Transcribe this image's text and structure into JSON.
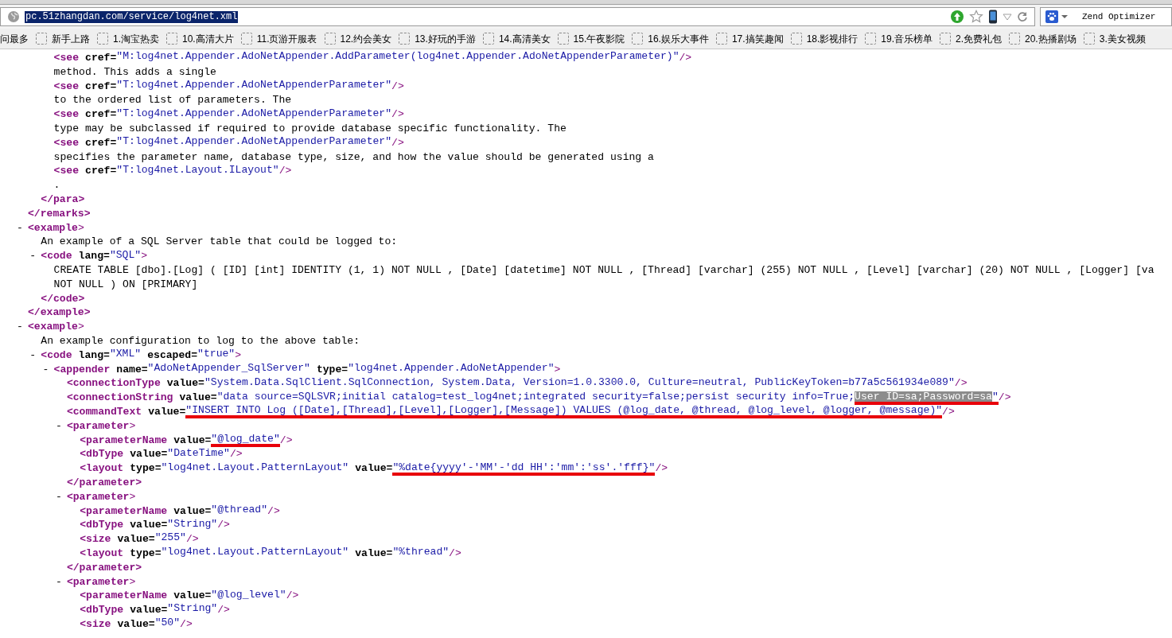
{
  "address_bar": {
    "url": "pc.51zhangdan.com/service/log4net.xml",
    "url_selected": true
  },
  "search_field": {
    "placeholder": "Zend Optimizer"
  },
  "bookmarks": [
    {
      "label": "问最多",
      "kind": "text"
    },
    {
      "label": "新手上路",
      "kind": "page"
    },
    {
      "label": "1.淘宝热卖",
      "kind": "page"
    },
    {
      "label": "10.高清大片",
      "kind": "page"
    },
    {
      "label": "11.页游开服表",
      "kind": "page"
    },
    {
      "label": "12.约会美女",
      "kind": "page"
    },
    {
      "label": "13.好玩的手游",
      "kind": "page"
    },
    {
      "label": "14.高清美女",
      "kind": "page"
    },
    {
      "label": "15.午夜影院",
      "kind": "page"
    },
    {
      "label": "16.娱乐大事件",
      "kind": "page"
    },
    {
      "label": "17.搞笑趣闻",
      "kind": "page"
    },
    {
      "label": "18.影视排行",
      "kind": "page"
    },
    {
      "label": "19.音乐榜单",
      "kind": "page"
    },
    {
      "label": "2.免费礼包",
      "kind": "page"
    },
    {
      "label": "20.热播剧场",
      "kind": "page"
    },
    {
      "label": "3.美女视频",
      "kind": "page"
    }
  ],
  "xml_view": [
    {
      "kind": "element",
      "close_tag": [
        {
          "kind": "close",
          "text": "</remarks>"
        }
      ],
      "children": [
        {
          "kind": "element",
          "close_tag": [
            {
              "kind": "close",
              "text": "</para>"
            }
          ],
          "children": [
            {
              "kind": "empty",
              "tag": [
                {
                  "kind": "open",
                  "text": "<see"
                },
                {
                  "kind": "attr",
                  "text": "cref="
                },
                {
                  "kind": "value",
                  "text": "\"M:log4net.Appender.AdoNetAppender.AddParameter(log4net.Appender.AdoNetAppenderParameter)\"",
                  "underlined": false
                },
                {
                  "kind": "end",
                  "text": "/>"
                }
              ]
            },
            {
              "kind": "text",
              "text": "method. This adds a single"
            },
            {
              "kind": "empty",
              "tag": [
                {
                  "kind": "open",
                  "text": "<see"
                },
                {
                  "kind": "attr",
                  "text": "cref="
                },
                {
                  "kind": "value",
                  "text": "\"T:log4net.Appender.AdoNetAppenderParameter\"",
                  "underlined": false
                },
                {
                  "kind": "end",
                  "text": "/>"
                }
              ]
            },
            {
              "kind": "text",
              "text": "to the ordered list of parameters. The"
            },
            {
              "kind": "empty",
              "tag": [
                {
                  "kind": "open",
                  "text": "<see"
                },
                {
                  "kind": "attr",
                  "text": "cref="
                },
                {
                  "kind": "value",
                  "text": "\"T:log4net.Appender.AdoNetAppenderParameter\"",
                  "underlined": false
                },
                {
                  "kind": "end",
                  "text": "/>"
                }
              ]
            },
            {
              "kind": "text",
              "text": "type may be subclassed if required to provide database specific functionality. The"
            },
            {
              "kind": "empty",
              "tag": [
                {
                  "kind": "open",
                  "text": "<see"
                },
                {
                  "kind": "attr",
                  "text": "cref="
                },
                {
                  "kind": "value",
                  "text": "\"T:log4net.Appender.AdoNetAppenderParameter\"",
                  "underlined": false
                },
                {
                  "kind": "end",
                  "text": "/>"
                }
              ]
            },
            {
              "kind": "text",
              "text": "specifies the parameter name, database type, size, and how the value should be generated using a"
            },
            {
              "kind": "empty",
              "tag": [
                {
                  "kind": "open",
                  "text": "<see"
                },
                {
                  "kind": "attr",
                  "text": "cref="
                },
                {
                  "kind": "value",
                  "text": "\"T:log4net.Layout.ILayout\"",
                  "underlined": false
                },
                {
                  "kind": "end",
                  "text": "/>"
                }
              ]
            },
            {
              "kind": "text",
              "text": "."
            }
          ]
        }
      ]
    },
    {
      "kind": "element",
      "toggle": "-",
      "open_tag": [
        {
          "kind": "open",
          "text": "<example"
        },
        {
          "kind": "end",
          "text": ">"
        }
      ],
      "close_tag": [
        {
          "kind": "close",
          "text": "</example>"
        }
      ],
      "children": [
        {
          "kind": "text",
          "text": "An example of a SQL Server table that could be logged to:"
        },
        {
          "kind": "element",
          "toggle": "-",
          "open_tag": [
            {
              "kind": "open",
              "text": "<code"
            },
            {
              "kind": "attr",
              "text": "lang="
            },
            {
              "kind": "value",
              "text": "\"SQL\"",
              "underlined": false
            },
            {
              "kind": "end",
              "text": ">"
            }
          ],
          "close_tag": [
            {
              "kind": "close",
              "text": "</code>"
            }
          ],
          "children": [
            {
              "kind": "text",
              "text": "CREATE TABLE [dbo].[Log] ( [ID] [int] IDENTITY (1, 1) NOT NULL , [Date] [datetime] NOT NULL , [Thread] [varchar] (255) NOT NULL , [Level] [varchar] (20) NOT NULL , [Logger] [va"
            },
            {
              "kind": "text",
              "text": "NOT NULL ) ON [PRIMARY]"
            }
          ]
        }
      ]
    },
    {
      "kind": "element",
      "toggle": "-",
      "open_tag": [
        {
          "kind": "open",
          "text": "<example"
        },
        {
          "kind": "end",
          "text": ">"
        }
      ],
      "children": [
        {
          "kind": "text",
          "text": "An example configuration to log to the above table:"
        },
        {
          "kind": "element",
          "toggle": "-",
          "open_tag": [
            {
              "kind": "open",
              "text": "<code"
            },
            {
              "kind": "attr",
              "text": "lang="
            },
            {
              "kind": "value",
              "text": "\"XML\"",
              "underlined": false
            },
            {
              "kind": "attr",
              "text": "escaped="
            },
            {
              "kind": "value",
              "text": "\"true\"",
              "underlined": false
            },
            {
              "kind": "end",
              "text": ">"
            }
          ],
          "children": [
            {
              "kind": "element",
              "toggle": "-",
              "open_tag": [
                {
                  "kind": "open",
                  "text": "<appender"
                },
                {
                  "kind": "attr",
                  "text": "name="
                },
                {
                  "kind": "value",
                  "text": "\"AdoNetAppender_SqlServer\"",
                  "underlined": false
                },
                {
                  "kind": "attr",
                  "text": "type="
                },
                {
                  "kind": "value",
                  "text": "\"log4net.Appender.AdoNetAppender\"",
                  "underlined": false
                },
                {
                  "kind": "end",
                  "text": ">"
                }
              ],
              "children": [
                {
                  "kind": "empty",
                  "tag": [
                    {
                      "kind": "open",
                      "text": "<connectionType"
                    },
                    {
                      "kind": "attr",
                      "text": "value="
                    },
                    {
                      "kind": "value",
                      "text": "\"System.Data.SqlClient.SqlConnection, System.Data, Version=1.0.3300.0, Culture=neutral, PublicKeyToken=b77a5c561934e089\"",
                      "underlined": false
                    },
                    {
                      "kind": "end",
                      "text": "/>"
                    }
                  ]
                },
                {
                  "kind": "empty",
                  "tag": [
                    {
                      "kind": "open",
                      "text": "<connectionString"
                    },
                    {
                      "kind": "attr",
                      "text": "value="
                    },
                    {
                      "kind": "value",
                      "text": "\"data source=SQLSVR;initial catalog=test_log4net;integrated security=false;persist security info=True;",
                      "underlined": false
                    },
                    {
                      "kind": "selection",
                      "text": "User ID=sa;Password=sa",
                      "underlined": true
                    },
                    {
                      "kind": "value",
                      "text": "\"",
                      "underlined": true
                    },
                    {
                      "kind": "end",
                      "text": "/>"
                    }
                  ]
                },
                {
                  "kind": "empty",
                  "tag": [
                    {
                      "kind": "open",
                      "text": "<commandText"
                    },
                    {
                      "kind": "attr",
                      "text": "value="
                    },
                    {
                      "kind": "value",
                      "text": "\"INSERT INTO Log ([Date],[Thread],[Level],[Logger],[Message]) VALUES (@log_date, @thread, @log_level, @logger, @message)\"",
                      "underlined": true
                    },
                    {
                      "kind": "end",
                      "text": "/>"
                    }
                  ]
                },
                {
                  "kind": "element",
                  "toggle": "-",
                  "open_tag": [
                    {
                      "kind": "open",
                      "text": "<parameter"
                    },
                    {
                      "kind": "end",
                      "text": ">"
                    }
                  ],
                  "close_tag": [
                    {
                      "kind": "close",
                      "text": "</parameter>"
                    }
                  ],
                  "children": [
                    {
                      "kind": "empty",
                      "tag": [
                        {
                          "kind": "open",
                          "text": "<parameterName"
                        },
                        {
                          "kind": "attr",
                          "text": "value="
                        },
                        {
                          "kind": "value",
                          "text": "\"@log_date\"",
                          "underlined": true
                        },
                        {
                          "kind": "end",
                          "text": "/>"
                        }
                      ]
                    },
                    {
                      "kind": "empty",
                      "tag": [
                        {
                          "kind": "open",
                          "text": "<dbType"
                        },
                        {
                          "kind": "attr",
                          "text": "value="
                        },
                        {
                          "kind": "value",
                          "text": "\"DateTime\"",
                          "underlined": false
                        },
                        {
                          "kind": "end",
                          "text": "/>"
                        }
                      ]
                    },
                    {
                      "kind": "empty",
                      "tag": [
                        {
                          "kind": "open",
                          "text": "<layout"
                        },
                        {
                          "kind": "attr",
                          "text": "type="
                        },
                        {
                          "kind": "value",
                          "text": "\"log4net.Layout.PatternLayout\"",
                          "underlined": false
                        },
                        {
                          "kind": "attr",
                          "text": "value="
                        },
                        {
                          "kind": "value",
                          "text": "\"%date{yyyy'-'MM'-'dd HH':'mm':'ss'.'fff}\"",
                          "underlined": true
                        },
                        {
                          "kind": "end",
                          "text": "/>"
                        }
                      ]
                    }
                  ]
                },
                {
                  "kind": "element",
                  "toggle": "-",
                  "open_tag": [
                    {
                      "kind": "open",
                      "text": "<parameter"
                    },
                    {
                      "kind": "end",
                      "text": ">"
                    }
                  ],
                  "close_tag": [
                    {
                      "kind": "close",
                      "text": "</parameter>"
                    }
                  ],
                  "children": [
                    {
                      "kind": "empty",
                      "tag": [
                        {
                          "kind": "open",
                          "text": "<parameterName"
                        },
                        {
                          "kind": "attr",
                          "text": "value="
                        },
                        {
                          "kind": "value",
                          "text": "\"@thread\"",
                          "underlined": false
                        },
                        {
                          "kind": "end",
                          "text": "/>"
                        }
                      ]
                    },
                    {
                      "kind": "empty",
                      "tag": [
                        {
                          "kind": "open",
                          "text": "<dbType"
                        },
                        {
                          "kind": "attr",
                          "text": "value="
                        },
                        {
                          "kind": "value",
                          "text": "\"String\"",
                          "underlined": false
                        },
                        {
                          "kind": "end",
                          "text": "/>"
                        }
                      ]
                    },
                    {
                      "kind": "empty",
                      "tag": [
                        {
                          "kind": "open",
                          "text": "<size"
                        },
                        {
                          "kind": "attr",
                          "text": "value="
                        },
                        {
                          "kind": "value",
                          "text": "\"255\"",
                          "underlined": false
                        },
                        {
                          "kind": "end",
                          "text": "/>"
                        }
                      ]
                    },
                    {
                      "kind": "empty",
                      "tag": [
                        {
                          "kind": "open",
                          "text": "<layout"
                        },
                        {
                          "kind": "attr",
                          "text": "type="
                        },
                        {
                          "kind": "value",
                          "text": "\"log4net.Layout.PatternLayout\"",
                          "underlined": false
                        },
                        {
                          "kind": "attr",
                          "text": "value="
                        },
                        {
                          "kind": "value",
                          "text": "\"%thread\"",
                          "underlined": false
                        },
                        {
                          "kind": "end",
                          "text": "/>"
                        }
                      ]
                    }
                  ]
                },
                {
                  "kind": "element",
                  "toggle": "-",
                  "open_tag": [
                    {
                      "kind": "open",
                      "text": "<parameter"
                    },
                    {
                      "kind": "end",
                      "text": ">"
                    }
                  ],
                  "children": [
                    {
                      "kind": "empty",
                      "tag": [
                        {
                          "kind": "open",
                          "text": "<parameterName"
                        },
                        {
                          "kind": "attr",
                          "text": "value="
                        },
                        {
                          "kind": "value",
                          "text": "\"@log_level\"",
                          "underlined": false
                        },
                        {
                          "kind": "end",
                          "text": "/>"
                        }
                      ]
                    },
                    {
                      "kind": "empty",
                      "tag": [
                        {
                          "kind": "open",
                          "text": "<dbType"
                        },
                        {
                          "kind": "attr",
                          "text": "value="
                        },
                        {
                          "kind": "value",
                          "text": "\"String\"",
                          "underlined": false
                        },
                        {
                          "kind": "end",
                          "text": "/>"
                        }
                      ]
                    },
                    {
                      "kind": "empty",
                      "tag": [
                        {
                          "kind": "open",
                          "text": "<size"
                        },
                        {
                          "kind": "attr",
                          "text": "value="
                        },
                        {
                          "kind": "value",
                          "text": "\"50\"",
                          "underlined": false
                        },
                        {
                          "kind": "end",
                          "text": "/>"
                        }
                      ]
                    }
                  ]
                }
              ]
            }
          ]
        }
      ]
    }
  ]
}
